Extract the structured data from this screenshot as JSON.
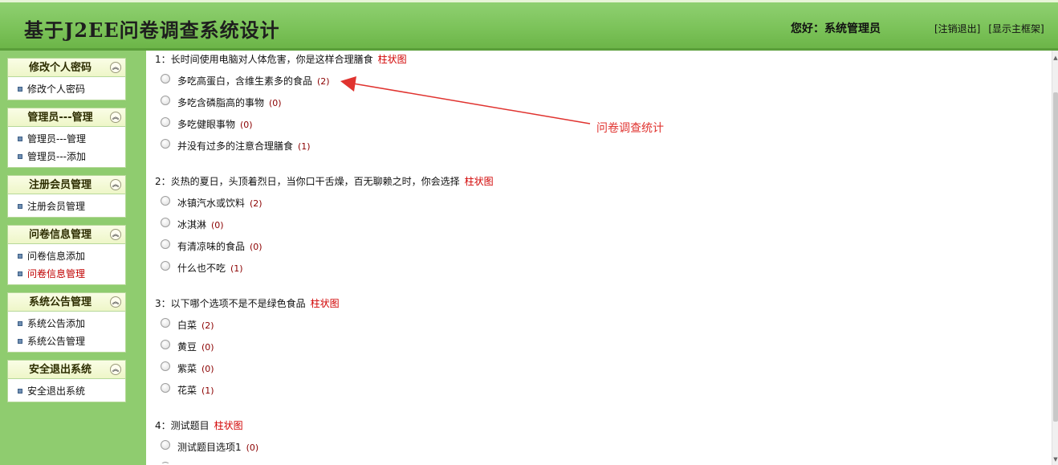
{
  "header": {
    "title": "基于J2EE问卷调查系统设计",
    "greeting": "您好：系统管理员",
    "links": [
      "[注销退出]",
      "[显示主框架]"
    ]
  },
  "sidebar": {
    "groups": [
      {
        "title": "修改个人密码",
        "items": [
          {
            "label": "修改个人密码",
            "active": false
          }
        ]
      },
      {
        "title": "管理员---管理",
        "items": [
          {
            "label": "管理员---管理",
            "active": false
          },
          {
            "label": "管理员---添加",
            "active": false
          }
        ]
      },
      {
        "title": "注册会员管理",
        "items": [
          {
            "label": "注册会员管理",
            "active": false
          }
        ]
      },
      {
        "title": "问卷信息管理",
        "items": [
          {
            "label": "问卷信息添加",
            "active": false
          },
          {
            "label": "问卷信息管理",
            "active": true
          }
        ]
      },
      {
        "title": "系统公告管理",
        "items": [
          {
            "label": "系统公告添加",
            "active": false
          },
          {
            "label": "系统公告管理",
            "active": false
          }
        ]
      },
      {
        "title": "安全退出系统",
        "items": [
          {
            "label": "安全退出系统",
            "active": false
          }
        ]
      }
    ],
    "collapse_icon": "double-chevron-up-icon"
  },
  "questions": [
    {
      "num": "1：",
      "text": "长时间使用电脑对人体危害，你是这样合理膳食",
      "chart_link": "柱状图",
      "options": [
        {
          "label": "多吃高蛋白，含维生素多的食品",
          "count": "(2)"
        },
        {
          "label": "多吃含磷脂高的事物",
          "count": "(0)"
        },
        {
          "label": "多吃健眼事物",
          "count": "(0)"
        },
        {
          "label": "并没有过多的注意合理膳食",
          "count": "(1)"
        }
      ]
    },
    {
      "num": "2：",
      "text": "炎热的夏日，头顶着烈日，当你口干舌燥，百无聊赖之时，你会选择",
      "chart_link": "柱状图",
      "options": [
        {
          "label": "冰镇汽水或饮料",
          "count": "(2)"
        },
        {
          "label": "冰淇淋",
          "count": "(0)"
        },
        {
          "label": "有清凉味的食品",
          "count": "(0)"
        },
        {
          "label": "什么也不吃",
          "count": "(1)"
        }
      ]
    },
    {
      "num": "3：",
      "text": "以下哪个选项不是不是绿色食品",
      "chart_link": "柱状图",
      "options": [
        {
          "label": "白菜",
          "count": "(2)"
        },
        {
          "label": "黄豆",
          "count": "(0)"
        },
        {
          "label": "紫菜",
          "count": "(0)"
        },
        {
          "label": "花菜",
          "count": "(1)"
        }
      ]
    },
    {
      "num": "4：",
      "text": "测试题目",
      "chart_link": "柱状图",
      "options": [
        {
          "label": "测试题目选项1",
          "count": "(0)"
        }
      ]
    }
  ],
  "annotation": {
    "text": "问卷调查统计",
    "color": "#e0332f"
  },
  "colors": {
    "header_green": "#7cc35a",
    "sidebar_green": "#8fcc6f",
    "link_red": "#d10000"
  }
}
